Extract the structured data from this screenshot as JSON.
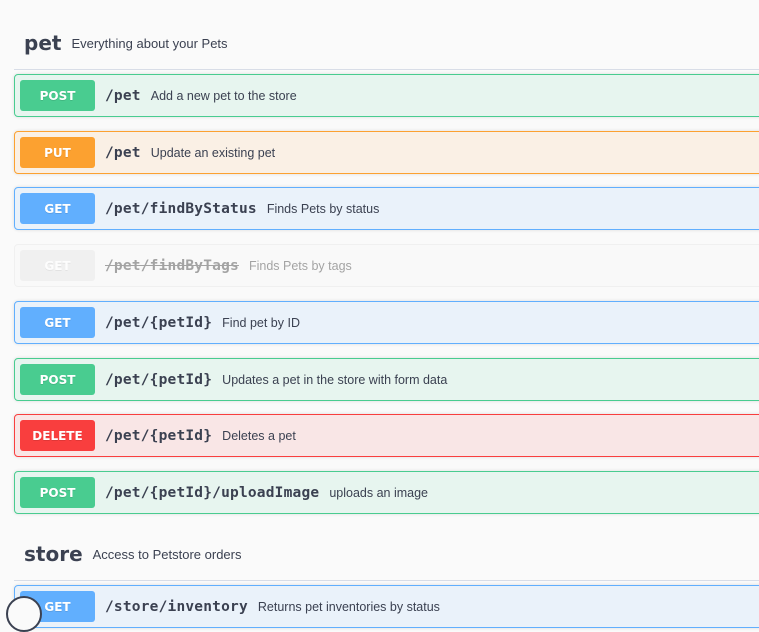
{
  "sections": [
    {
      "tag": "pet",
      "description": "Everything about your Pets"
    },
    {
      "tag": "store",
      "description": "Access to Petstore orders"
    }
  ],
  "operations": [
    {
      "method": "POST",
      "path": "/pet",
      "summary": "Add a new pet to the store"
    },
    {
      "method": "PUT",
      "path": "/pet",
      "summary": "Update an existing pet"
    },
    {
      "method": "GET",
      "path": "/pet/findByStatus",
      "summary": "Finds Pets by status"
    },
    {
      "method": "GET",
      "path": "/pet/findByTags",
      "summary": "Finds Pets by tags",
      "deprecated": true
    },
    {
      "method": "GET",
      "path": "/pet/{petId}",
      "summary": "Find pet by ID"
    },
    {
      "method": "POST",
      "path": "/pet/{petId}",
      "summary": "Updates a pet in the store with form data"
    },
    {
      "method": "DELETE",
      "path": "/pet/{petId}",
      "summary": "Deletes a pet"
    },
    {
      "method": "POST",
      "path": "/pet/{petId}/uploadImage",
      "summary": "uploads an image"
    },
    {
      "method": "GET",
      "path": "/store/inventory",
      "summary": "Returns pet inventories by status"
    }
  ],
  "colors": {
    "post": "#49cc90",
    "put": "#fca130",
    "get": "#61affe",
    "delete": "#f93e3e",
    "deprecated": "#ebebeb"
  }
}
